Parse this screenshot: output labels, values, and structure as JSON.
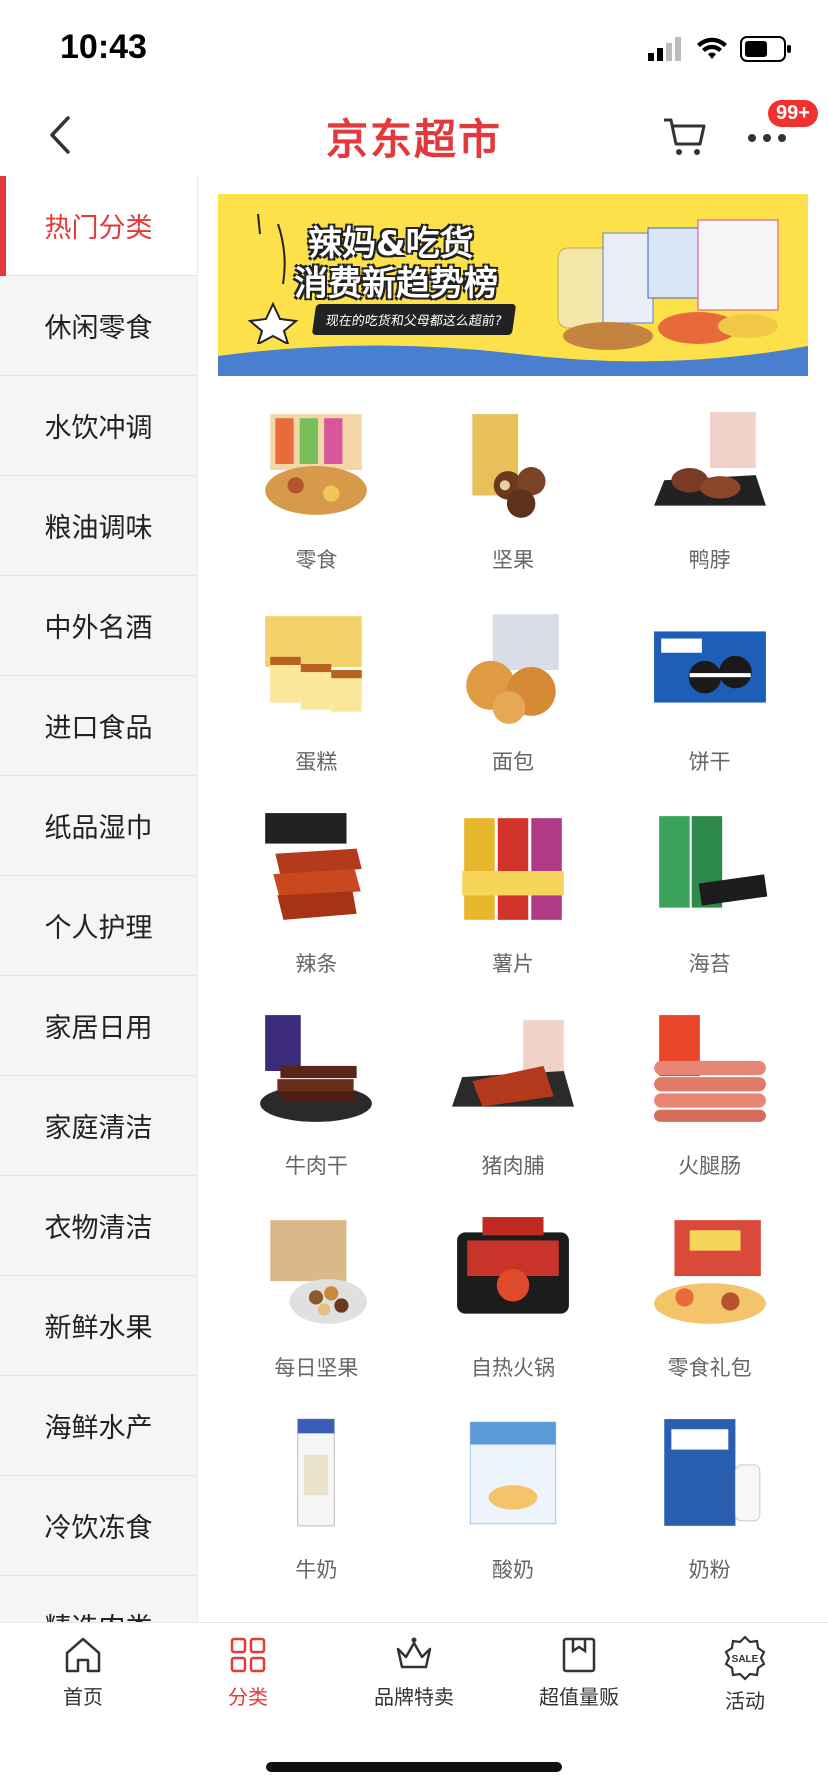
{
  "status": {
    "time": "10:43"
  },
  "nav": {
    "title": "京东超市",
    "badge": "99+"
  },
  "sidebar": {
    "items": [
      {
        "label": "热门分类"
      },
      {
        "label": "休闲零食"
      },
      {
        "label": "水饮冲调"
      },
      {
        "label": "粮油调味"
      },
      {
        "label": "中外名酒"
      },
      {
        "label": "进口食品"
      },
      {
        "label": "纸品湿巾"
      },
      {
        "label": "个人护理"
      },
      {
        "label": "家居日用"
      },
      {
        "label": "家庭清洁"
      },
      {
        "label": "衣物清洁"
      },
      {
        "label": "新鲜水果"
      },
      {
        "label": "海鲜水产"
      },
      {
        "label": "冷饮冻食"
      },
      {
        "label": "精选肉类"
      }
    ]
  },
  "banner": {
    "line1": "辣妈&吃货",
    "line2": "消费新趋势榜",
    "sub": "现在的吃货和父母都这么超前?"
  },
  "categories": [
    {
      "label": "零食"
    },
    {
      "label": "坚果"
    },
    {
      "label": "鸭脖"
    },
    {
      "label": "蛋糕"
    },
    {
      "label": "面包"
    },
    {
      "label": "饼干"
    },
    {
      "label": "辣条"
    },
    {
      "label": "薯片"
    },
    {
      "label": "海苔"
    },
    {
      "label": "牛肉干"
    },
    {
      "label": "猪肉脯"
    },
    {
      "label": "火腿肠"
    },
    {
      "label": "每日坚果"
    },
    {
      "label": "自热火锅"
    },
    {
      "label": "零食礼包"
    },
    {
      "label": "牛奶"
    },
    {
      "label": "酸奶"
    },
    {
      "label": "奶粉"
    }
  ],
  "tabbar": {
    "items": [
      {
        "label": "首页"
      },
      {
        "label": "分类"
      },
      {
        "label": "品牌特卖"
      },
      {
        "label": "超值量贩"
      },
      {
        "label": "活动"
      }
    ]
  },
  "colors": {
    "accent": "#e4393c",
    "sidebar_bg": "#f5f5f5",
    "banner_bg": "#fde14a"
  }
}
